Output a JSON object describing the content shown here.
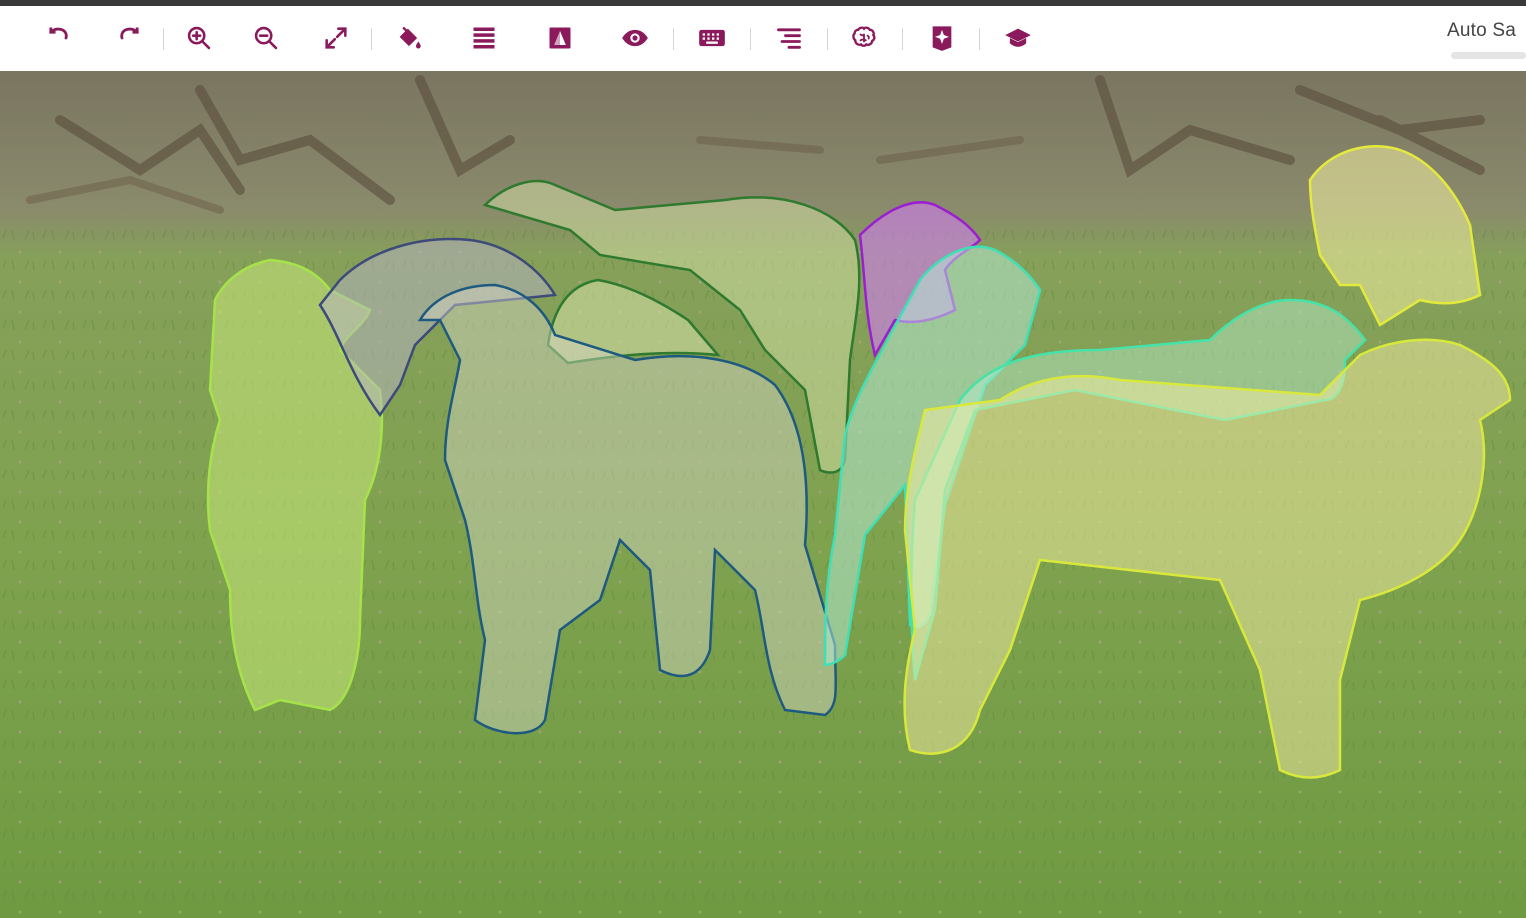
{
  "colors": {
    "accent": "#8b1a5c",
    "toolbar_bg": "#ffffff",
    "grass": "#7d9a52"
  },
  "toolbar": {
    "tools": [
      {
        "icon": "undo-icon"
      },
      {
        "icon": "redo-icon"
      },
      {
        "icon": "zoom-in-icon"
      },
      {
        "icon": "zoom-out-icon"
      },
      {
        "icon": "fit-screen-icon"
      },
      {
        "icon": "paint-bucket-icon"
      },
      {
        "icon": "layers-list-icon"
      },
      {
        "icon": "image-contrast-icon"
      },
      {
        "icon": "eye-icon"
      },
      {
        "icon": "keyboard-icon"
      },
      {
        "icon": "align-right-icon"
      },
      {
        "icon": "brain-icon"
      },
      {
        "icon": "magic-sparkle-icon"
      },
      {
        "icon": "graduation-cap-icon"
      }
    ],
    "auto_save_label": "Auto Sa"
  },
  "annotations": [
    {
      "label_color": "#a6e34a"
    },
    {
      "label_color": "#3d4a7a"
    },
    {
      "label_color": "#2f7a2f"
    },
    {
      "label_color": "#2f7a2f"
    },
    {
      "label_color": "#1e5a80"
    },
    {
      "label_color": "#9b1fd1"
    },
    {
      "label_color": "#3ee0b5"
    },
    {
      "label_color": "#45e3a8"
    },
    {
      "label_color": "#e4ea3c"
    },
    {
      "label_color": "#d8e83c"
    }
  ]
}
